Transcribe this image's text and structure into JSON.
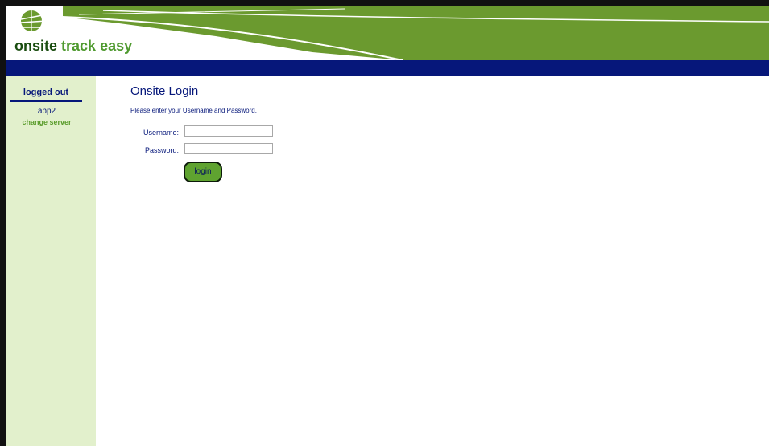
{
  "brand": {
    "name_part1": "onsite",
    "name_part2": "track easy"
  },
  "sidebar": {
    "status": "logged out",
    "server": "app2",
    "change_server": "change server"
  },
  "main": {
    "title": "Onsite Login",
    "instructions": "Please enter your Username and Password.",
    "username_label": "Username:",
    "username_value": "",
    "password_label": "Password:",
    "password_value": "",
    "login_button": "login"
  },
  "colors": {
    "banner_green": "#6b9a2f",
    "nav_blue": "#06177a",
    "sidebar_bg": "#e2f0cc",
    "button_green": "#5fa330"
  }
}
